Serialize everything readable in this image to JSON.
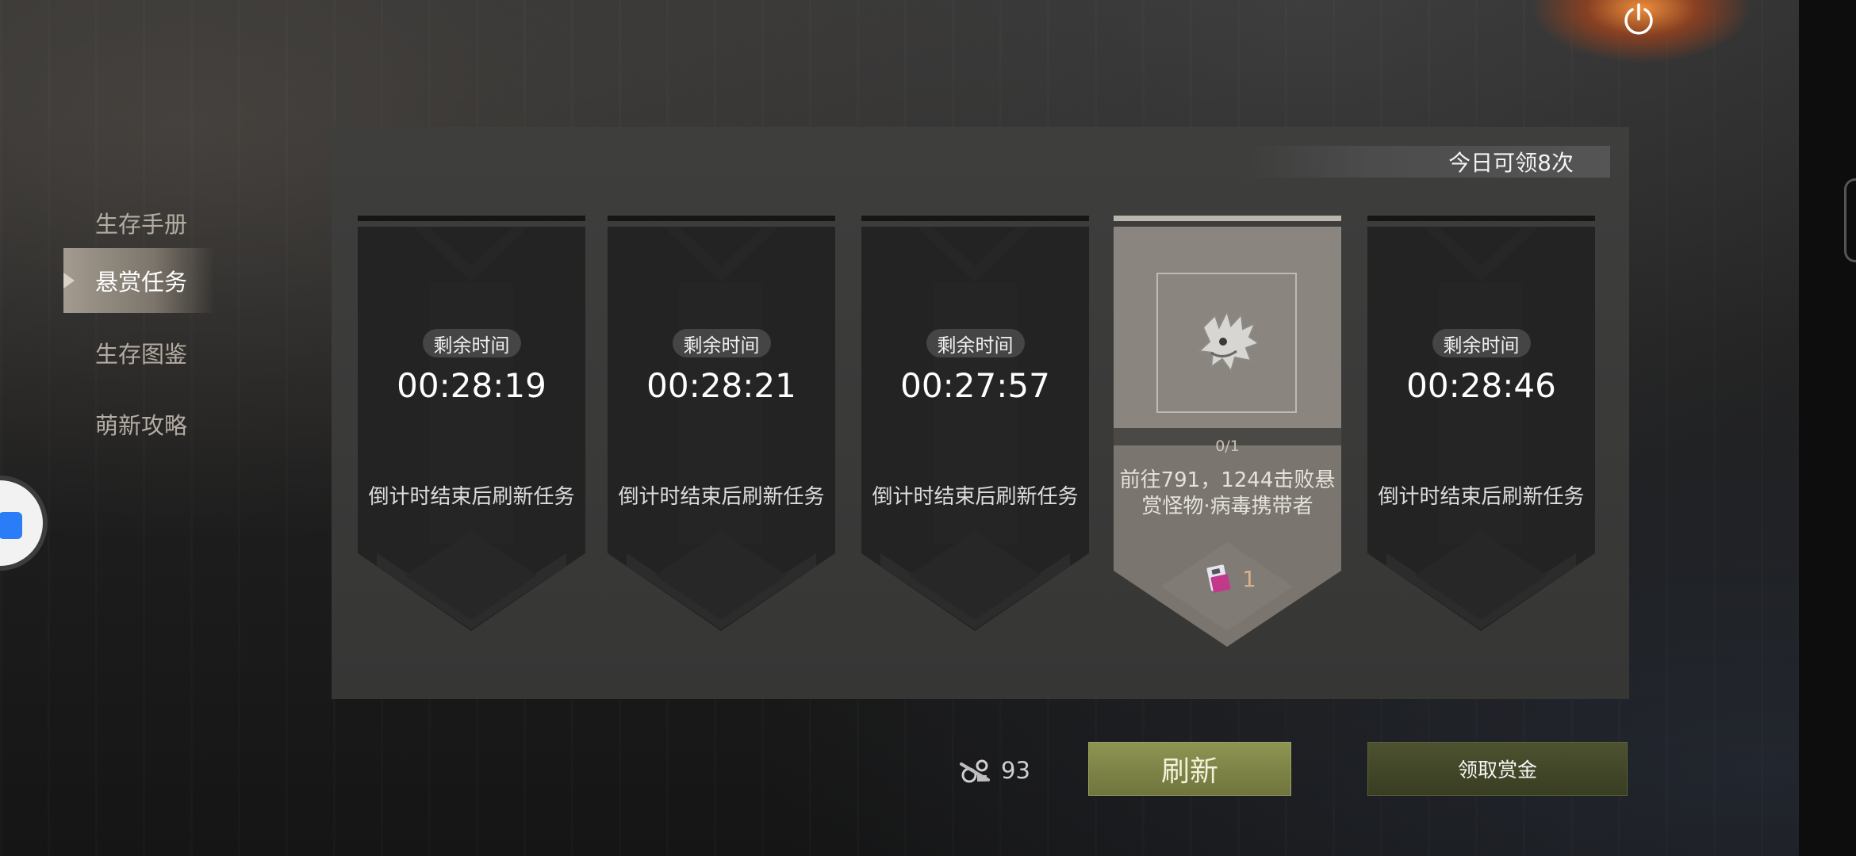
{
  "sidebar": {
    "items": [
      {
        "label": "生存手册",
        "active": false
      },
      {
        "label": "悬赏任务",
        "active": true
      },
      {
        "label": "生存图鉴",
        "active": false
      },
      {
        "label": "萌新攻略",
        "active": false
      }
    ]
  },
  "panel": {
    "daily_quota": "今日可领8次"
  },
  "cards": [
    {
      "badge": "剩余时间",
      "timer": "00:28:19",
      "hint": "倒计时结束后刷新任务"
    },
    {
      "badge": "剩余时间",
      "timer": "00:28:21",
      "hint": "倒计时结束后刷新任务"
    },
    {
      "badge": "剩余时间",
      "timer": "00:27:57",
      "hint": "倒计时结束后刷新任务"
    },
    {
      "progress": "0/1",
      "desc_line1": "前往791，1244击败悬",
      "desc_line2": "赏怪物·病毒携带者",
      "reward_count": "1",
      "monster_icon": "virus-carrier-monster-icon",
      "reward_icon": "reward-card-icon"
    },
    {
      "badge": "剩余时间",
      "timer": "00:28:46",
      "hint": "倒计时结束后刷新任务"
    }
  ],
  "footer": {
    "currency_icon": "parts-icon",
    "currency_amount": "93",
    "refresh_label": "刷新",
    "claim_label": "领取赏金"
  },
  "colors": {
    "accent_refresh": "#7c8245",
    "accent_claim": "#43482a",
    "reward_text": "#d9b08a"
  }
}
